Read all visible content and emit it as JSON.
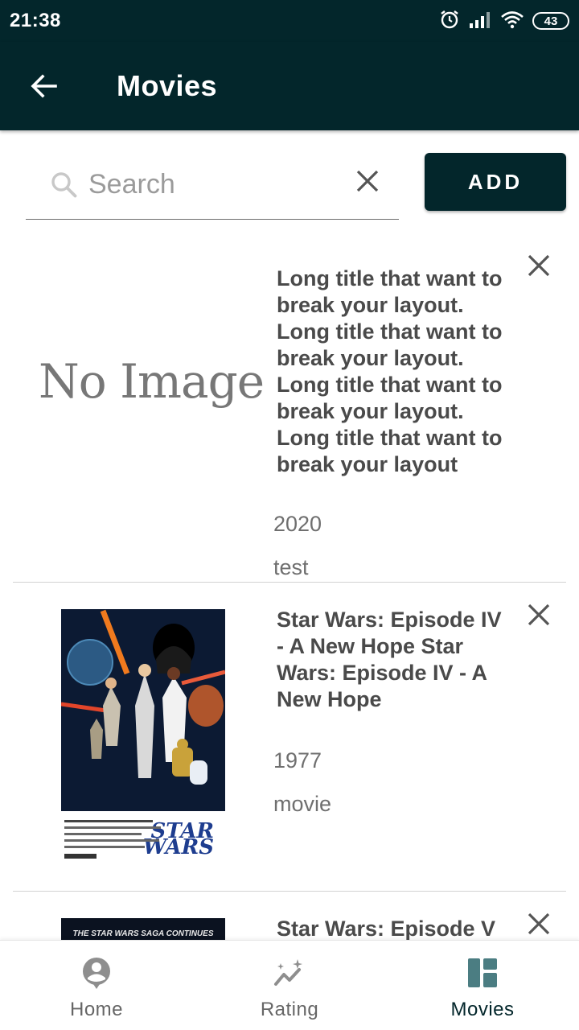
{
  "status_bar": {
    "time": "21:38",
    "battery": "43"
  },
  "app_bar": {
    "title": "Movies"
  },
  "search": {
    "placeholder": "Search",
    "value": ""
  },
  "add_button_label": "ADD",
  "movies": [
    {
      "title": "Long title that want to break your layout. Long title that want to break your layout. Long title that want to break your layout. Long title that want to break your layout",
      "year": "2020",
      "type": "test",
      "poster": "No Image"
    },
    {
      "title": "Star Wars: Episode IV - A New Hope Star Wars: Episode IV - A New Hope",
      "year": "1977",
      "type": "movie",
      "poster_text": "STAR WARS"
    },
    {
      "title": "Star Wars: Episode V",
      "poster_text": "THE STAR WARS SAGA CONTINUES"
    }
  ],
  "bottom_nav": {
    "items": [
      {
        "label": "Home",
        "icon": "person-icon"
      },
      {
        "label": "Rating",
        "icon": "trend-icon"
      },
      {
        "label": "Movies",
        "icon": "dashboard-icon",
        "active": true
      }
    ]
  },
  "colors": {
    "primary": "#03262b",
    "text": "#4a4a4a",
    "muted": "#6f6f6f"
  }
}
